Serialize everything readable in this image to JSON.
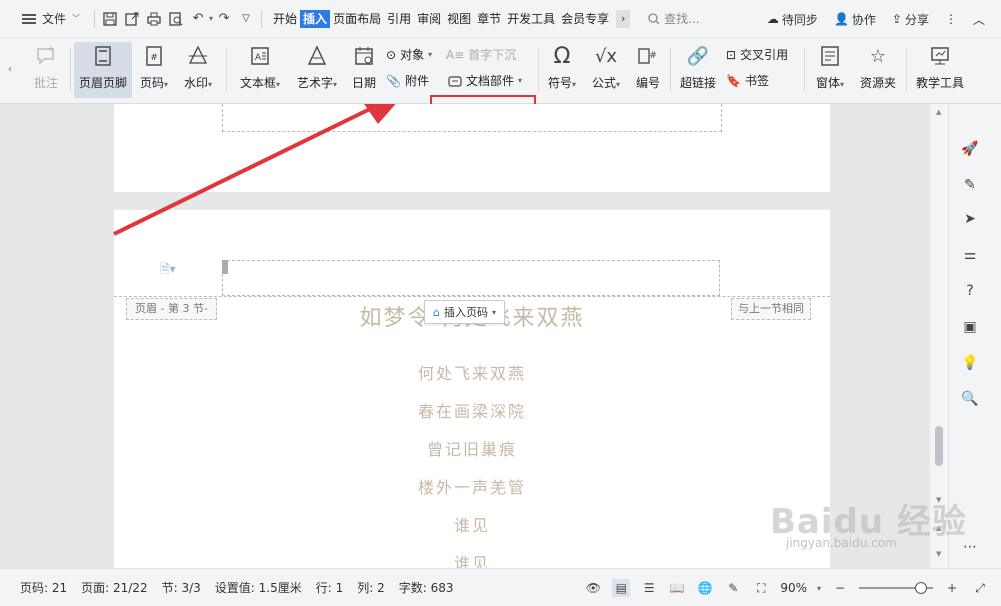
{
  "menubar": {
    "file_label": "文件",
    "tabs": [
      "开始",
      "插入",
      "页面布局",
      "引用",
      "审阅",
      "视图",
      "章节",
      "开发工具",
      "会员专享"
    ],
    "active_tab": "插入",
    "search_label": "查找...",
    "right": {
      "sync": "待同步",
      "collab": "协作",
      "share": "分享"
    }
  },
  "ribbon": {
    "comment": "批注",
    "header_footer": "页眉页脚",
    "page_number": "页码",
    "watermark": "水印",
    "textbox": "文本框",
    "wordart": "艺术字",
    "date": "日期",
    "object": "对象",
    "drop_cap": "首字下沉",
    "attachment": "附件",
    "doc_parts": "文档部件",
    "symbol": "符号",
    "formula": "公式",
    "numbering": "编号",
    "hyperlink": "超链接",
    "cross_ref": "交叉引用",
    "bookmark": "书签",
    "form": "窗体",
    "resources": "资源夹",
    "teaching": "教学工具"
  },
  "document": {
    "header_label": "页眉  - 第 3 节-",
    "same_as_prev": "与上一节相同",
    "insert_page_number": "插入页码",
    "title": "如梦令 何处飞来双燕",
    "lines": [
      "何处飞来双燕",
      "春在画梁深院",
      "曾记旧巢痕",
      "楼外一声羌管",
      "谁见",
      "谁见"
    ]
  },
  "status": {
    "page_num": "页码: 21",
    "page": "页面: 21/22",
    "section": "节: 3/3",
    "setting": "设置值: 1.5厘米",
    "row": "行: 1",
    "col": "列: 2",
    "words": "字数: 683",
    "zoom": "90%"
  },
  "watermark": {
    "text": "Baidu 经验",
    "sub": "jingyan.baidu.com"
  },
  "colors": {
    "accent": "#2f7be5",
    "highlight": "#e0363b",
    "poem": "#c8b9a6"
  }
}
